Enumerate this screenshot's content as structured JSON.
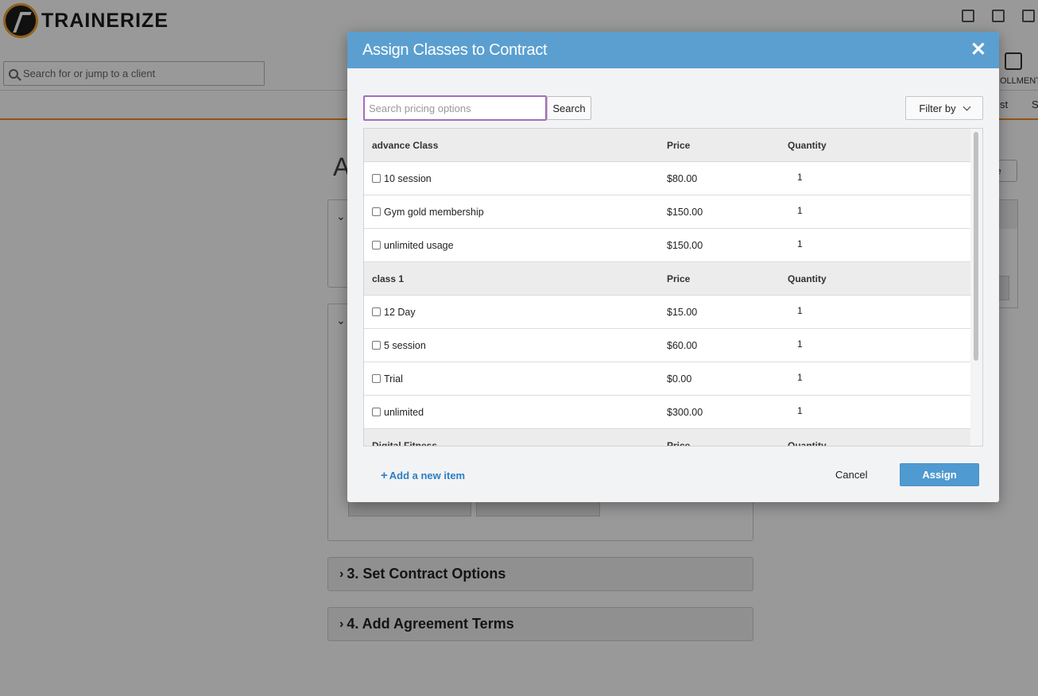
{
  "app": {
    "logo_text": "TRAINERIZE",
    "client_search_placeholder": "Search for or jump to a client",
    "enrollment_label": "ROLLMENT",
    "subnav_partial_a": "st",
    "subnav_partial_b": "S",
    "page_title_partial": "A",
    "right_button_partial": "e"
  },
  "sections": {
    "contract_options": "3. Set Contract Options",
    "agreement_terms": "4. Add Agreement Terms"
  },
  "modal": {
    "title": "Assign Classes to Contract",
    "close_symbol": "✕",
    "search_placeholder": "Search pricing options",
    "search_button": "Search",
    "filter_button": "Filter by",
    "groups": [
      {
        "name": "advance Class",
        "price_header": "Price",
        "quantity_header": "Quantity",
        "items": [
          {
            "name": "10 session",
            "price": "$80.00",
            "quantity": "1"
          },
          {
            "name": "Gym gold membership",
            "price": "$150.00",
            "quantity": "1"
          },
          {
            "name": "unlimited usage",
            "price": "$150.00",
            "quantity": "1"
          }
        ]
      },
      {
        "name": "class 1",
        "price_header": "Price",
        "quantity_header": "Quantity",
        "items": [
          {
            "name": "12 Day",
            "price": "$15.00",
            "quantity": "1"
          },
          {
            "name": "5 session",
            "price": "$60.00",
            "quantity": "1"
          },
          {
            "name": "Trial",
            "price": "$0.00",
            "quantity": "1"
          },
          {
            "name": "unlimited",
            "price": "$300.00",
            "quantity": "1"
          }
        ]
      },
      {
        "name": "Digital Fitness",
        "price_header": "Price",
        "quantity_header": "Quantity",
        "items": []
      }
    ],
    "add_item": "Add a new item",
    "add_item_symbol": "+",
    "cancel": "Cancel",
    "assign": "Assign"
  }
}
